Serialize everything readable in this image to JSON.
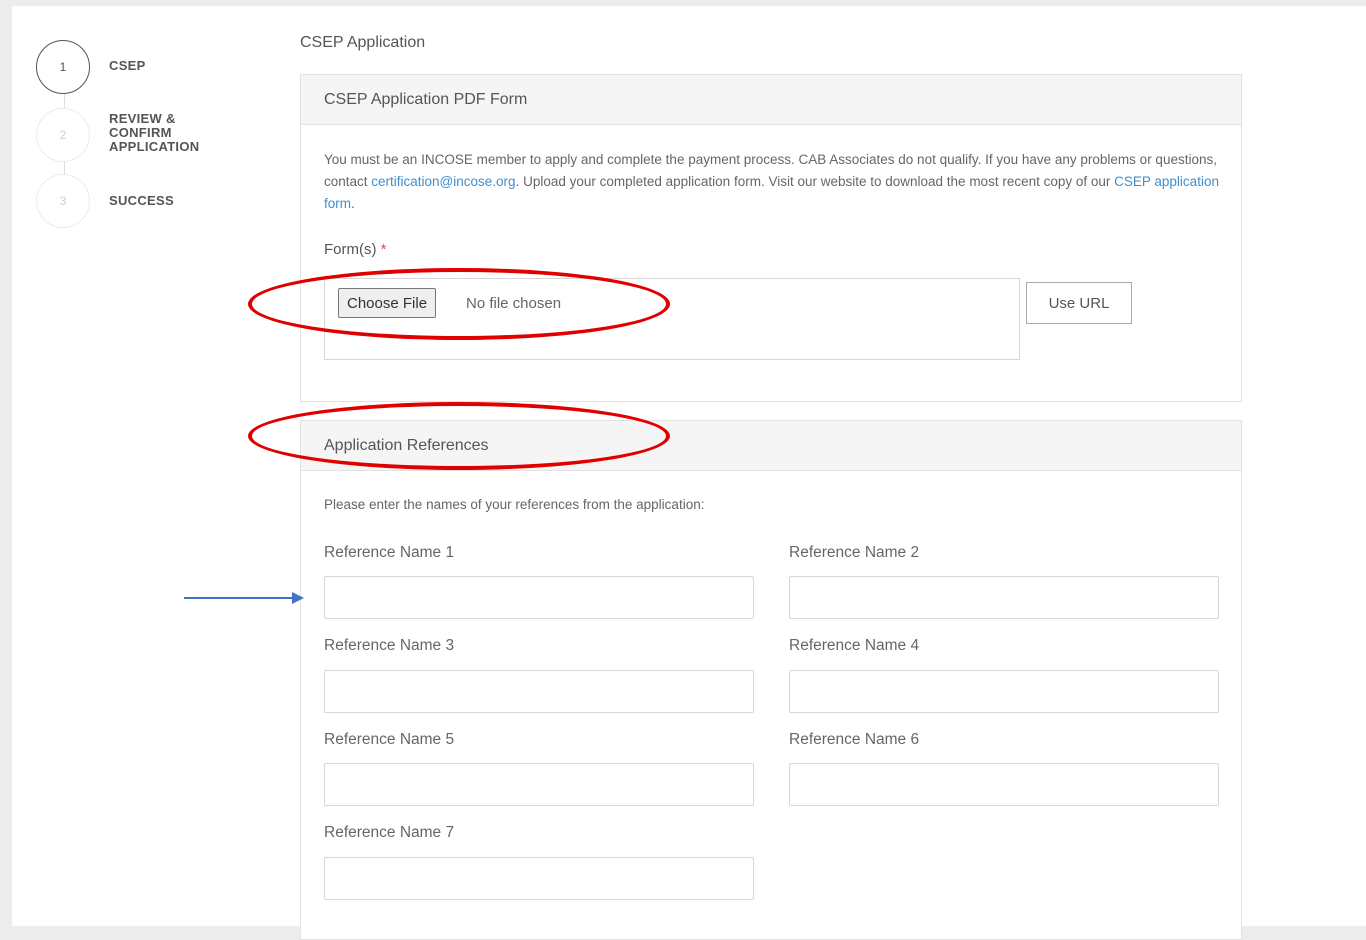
{
  "steps": [
    {
      "number": "1",
      "label": "CSEP",
      "state": "active"
    },
    {
      "number": "2",
      "label_lines": [
        "REVIEW &",
        "CONFIRM",
        "APPLICATION"
      ],
      "state": "inactive"
    },
    {
      "number": "3",
      "label": "SUCCESS",
      "state": "inactive"
    }
  ],
  "page_title": "CSEP Application",
  "pdf_panel": {
    "title": "CSEP Application PDF Form",
    "intro_part1": "You must be an INCOSE member to apply and complete the payment process.  CAB Associates do not qualify. If you have any problems or questions, contact ",
    "email_link": "certification@incose.org",
    "intro_part2": ".  Upload your completed application form. Visit our website to download the most recent copy of our ",
    "form_link": "CSEP application form",
    "intro_part3": ".",
    "forms_label": "Form(s)",
    "required_mark": "*",
    "choose_file_label": "Choose File",
    "no_file_text": "No file chosen",
    "use_url_label": "Use URL"
  },
  "references_panel": {
    "title": "Application References",
    "intro": "Please enter the names of your references from the application:",
    "fields": [
      {
        "label": "Reference Name 1",
        "value": ""
      },
      {
        "label": "Reference Name 2",
        "value": ""
      },
      {
        "label": "Reference Name 3",
        "value": ""
      },
      {
        "label": "Reference Name 4",
        "value": ""
      },
      {
        "label": "Reference Name 5",
        "value": ""
      },
      {
        "label": "Reference Name 6",
        "value": ""
      },
      {
        "label": "Reference Name 7",
        "value": ""
      }
    ]
  },
  "annotations": {
    "ellipse_color": "#e00000",
    "arrow_color": "#4472c4"
  }
}
